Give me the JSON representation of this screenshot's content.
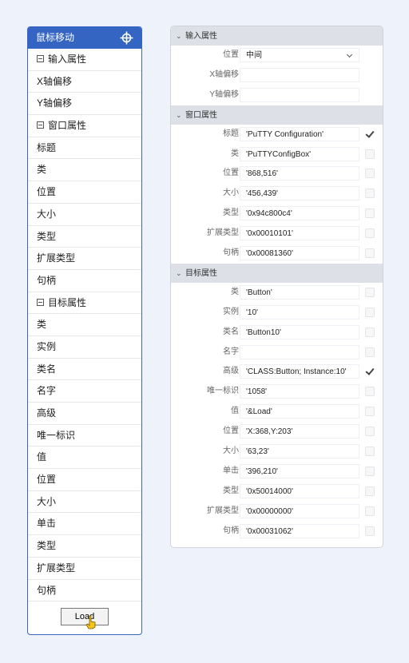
{
  "left_panel": {
    "title": "鼠标移动",
    "items": [
      {
        "label": "输入属性",
        "group": true
      },
      {
        "label": "X轴偏移"
      },
      {
        "label": "Y轴偏移"
      },
      {
        "label": "窗口属性",
        "group": true
      },
      {
        "label": "标题"
      },
      {
        "label": "类"
      },
      {
        "label": "位置"
      },
      {
        "label": "大小"
      },
      {
        "label": "类型"
      },
      {
        "label": "扩展类型"
      },
      {
        "label": "句柄"
      },
      {
        "label": "目标属性",
        "group": true
      },
      {
        "label": "类"
      },
      {
        "label": "实例"
      },
      {
        "label": "类名"
      },
      {
        "label": "名字"
      },
      {
        "label": "高级"
      },
      {
        "label": "唯一标识"
      },
      {
        "label": "值"
      },
      {
        "label": "位置"
      },
      {
        "label": "大小"
      },
      {
        "label": "单击"
      },
      {
        "label": "类型"
      },
      {
        "label": "扩展类型"
      },
      {
        "label": "句柄"
      }
    ],
    "load_button": "Load"
  },
  "right_panel": {
    "sections": [
      {
        "title": "输入属性",
        "rows": [
          {
            "label": "位置",
            "value": "中间",
            "select": true
          },
          {
            "label": "X轴偏移",
            "value": ""
          },
          {
            "label": "Y轴偏移",
            "value": ""
          }
        ]
      },
      {
        "title": "窗口属性",
        "rows": [
          {
            "label": "标题",
            "value": "'PuTTY Configuration'",
            "checked": true
          },
          {
            "label": "类",
            "value": "'PuTTYConfigBox'",
            "checked": false
          },
          {
            "label": "位置",
            "value": "'868,516'",
            "checked": false
          },
          {
            "label": "大小",
            "value": "'456,439'",
            "checked": false
          },
          {
            "label": "类型",
            "value": "'0x94c800c4'",
            "checked": false
          },
          {
            "label": "扩展类型",
            "value": "'0x00010101'",
            "checked": false
          },
          {
            "label": "句柄",
            "value": "'0x00081360'",
            "checked": false
          }
        ]
      },
      {
        "title": "目标属性",
        "rows": [
          {
            "label": "类",
            "value": "'Button'",
            "checked": false
          },
          {
            "label": "实例",
            "value": "'10'",
            "checked": false
          },
          {
            "label": "类名",
            "value": "'Button10'",
            "checked": false
          },
          {
            "label": "名字",
            "value": "",
            "checked": false
          },
          {
            "label": "高级",
            "value": "'CLASS:Button; Instance:10'",
            "checked": true
          },
          {
            "label": "唯一标识",
            "value": "'1058'",
            "checked": false
          },
          {
            "label": "值",
            "value": "'&Load'",
            "checked": false
          },
          {
            "label": "位置",
            "value": "'X:368,Y:203'",
            "checked": false
          },
          {
            "label": "大小",
            "value": "'63,23'",
            "checked": false
          },
          {
            "label": "单击",
            "value": "'396,210'",
            "checked": false
          },
          {
            "label": "类型",
            "value": "'0x50014000'",
            "checked": false
          },
          {
            "label": "扩展类型",
            "value": "'0x00000000'",
            "checked": false
          },
          {
            "label": "句柄",
            "value": "'0x00031062'",
            "checked": false
          }
        ]
      }
    ]
  },
  "colors": {
    "accent": "#3465c2",
    "background": "#eef2fa",
    "section_header": "#dde1e7"
  },
  "icons": {
    "title": "crosshair-icon",
    "group": "collapse-box-icon",
    "section": "chevron-down-icon",
    "cursor": "hand-pointer-icon"
  }
}
